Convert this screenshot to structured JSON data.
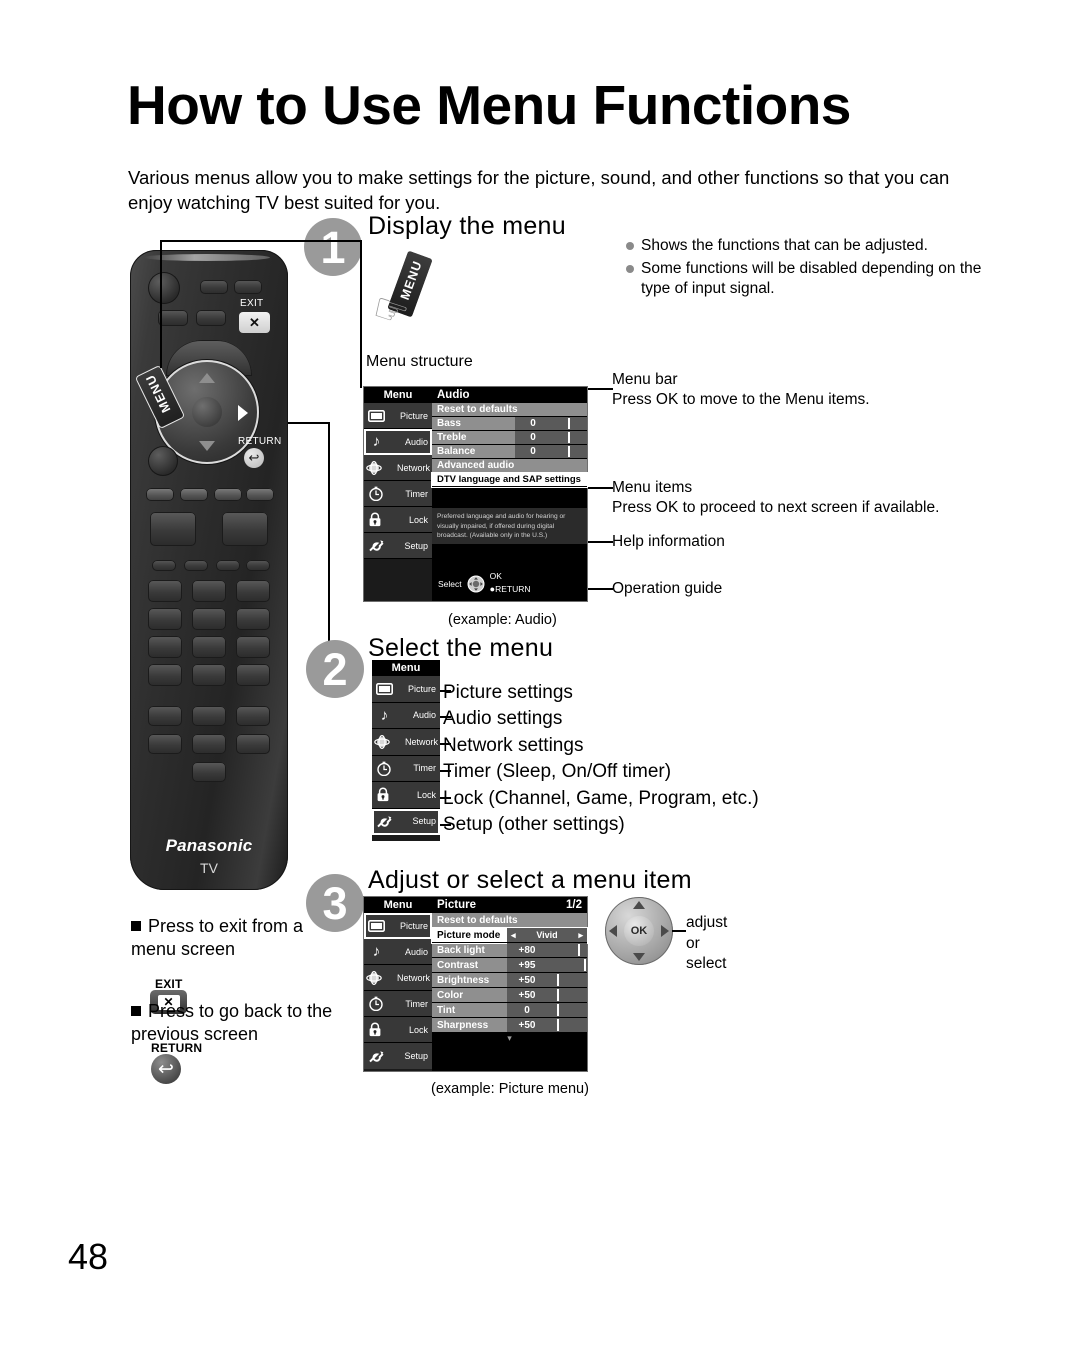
{
  "page": {
    "title": "How to Use Menu Functions",
    "intro": "Various menus allow you to make settings for the picture, sound, and other functions so that you can enjoy watching TV best suited for you.",
    "page_number": "48"
  },
  "remote": {
    "brand": "Panasonic",
    "sub_brand": "TV",
    "menu_key": "MENU",
    "exit_key_label": "EXIT",
    "exit_key_glyph": "✕",
    "return_key_label": "RETURN",
    "return_key_glyph": "↩"
  },
  "step1": {
    "number": "1",
    "title": "Display the menu",
    "press_tag": "MENU",
    "bullets": [
      "Shows the functions that can be adjusted.",
      "Some functions will be disabled depending on the type of input signal."
    ],
    "menu_structure_label": "Menu structure",
    "caption": "(example: Audio)",
    "callouts": [
      {
        "title": "Menu bar",
        "desc": "Press OK to move to the Menu items."
      },
      {
        "title": "Menu items",
        "desc": "Press OK to proceed to next screen if available."
      },
      {
        "title": "Help information",
        "desc": ""
      },
      {
        "title": "Operation guide",
        "desc": ""
      }
    ],
    "osd": {
      "sidebar_title": "Menu",
      "sidebar_items": [
        {
          "label": "Picture",
          "icon": "picture-icon",
          "selected": false
        },
        {
          "label": "Audio",
          "icon": "audio-icon",
          "selected": true
        },
        {
          "label": "Network",
          "icon": "network-icon",
          "selected": false
        },
        {
          "label": "Timer",
          "icon": "timer-icon",
          "selected": false
        },
        {
          "label": "Lock",
          "icon": "lock-icon",
          "selected": false
        },
        {
          "label": "Setup",
          "icon": "setup-icon",
          "selected": false
        }
      ],
      "main_title": "Audio",
      "page_indicator": "",
      "rows": [
        {
          "name": "Reset to defaults",
          "value": "",
          "type": "plain",
          "bar": null
        },
        {
          "name": "Bass",
          "value": "0",
          "type": "slider",
          "bar": 50
        },
        {
          "name": "Treble",
          "value": "0",
          "type": "slider",
          "bar": 50
        },
        {
          "name": "Balance",
          "value": "0",
          "type": "slider",
          "bar": 50
        },
        {
          "name": "Advanced audio",
          "value": "",
          "type": "plain",
          "bar": null
        },
        {
          "name": "DTV language and SAP settings",
          "value": "",
          "type": "highlight",
          "bar": null
        }
      ],
      "help_text": "Preferred language and audio for hearing or visually impaired, if offered during digital broadcast. (Available only in the U.S.)",
      "guide": {
        "select": "Select",
        "ok": "OK",
        "return": "RETURN"
      }
    }
  },
  "step2": {
    "number": "2",
    "title": "Select the menu",
    "osd_title": "Menu",
    "items": [
      {
        "label": "Picture",
        "icon": "picture-icon",
        "desc": "Picture settings",
        "selected": false
      },
      {
        "label": "Audio",
        "icon": "audio-icon",
        "desc": "Audio settings",
        "selected": false
      },
      {
        "label": "Network",
        "icon": "network-icon",
        "desc": "Network settings",
        "selected": false
      },
      {
        "label": "Timer",
        "icon": "timer-icon",
        "desc": "Timer (Sleep, On/Off timer)",
        "selected": false
      },
      {
        "label": "Lock",
        "icon": "lock-icon",
        "desc": "Lock (Channel, Game, Program, etc.)",
        "selected": false
      },
      {
        "label": "Setup",
        "icon": "setup-icon",
        "desc": "Setup (other settings)",
        "selected": true
      }
    ]
  },
  "step3": {
    "number": "3",
    "title": "Adjust or select a menu item",
    "caption": "(example: Picture menu)",
    "adjust_label": "adjust\nor\nselect",
    "ok_label": "OK",
    "notes": [
      {
        "text": "Press to exit from a menu screen",
        "key_label": "EXIT",
        "key_glyph": "✕"
      },
      {
        "text": "Press to go back to the previous screen",
        "key_label": "RETURN",
        "key_glyph": "↩"
      }
    ],
    "osd": {
      "sidebar_title": "Menu",
      "sidebar_items": [
        {
          "label": "Picture",
          "icon": "picture-icon",
          "selected": true
        },
        {
          "label": "Audio",
          "icon": "audio-icon",
          "selected": false
        },
        {
          "label": "Network",
          "icon": "network-icon",
          "selected": false
        },
        {
          "label": "Timer",
          "icon": "timer-icon",
          "selected": false
        },
        {
          "label": "Lock",
          "icon": "lock-icon",
          "selected": false
        },
        {
          "label": "Setup",
          "icon": "setup-icon",
          "selected": false
        }
      ],
      "main_title": "Picture",
      "page_indicator": "1/2",
      "rows": [
        {
          "name": "Reset to defaults",
          "value": "",
          "type": "plain",
          "bar": null
        },
        {
          "name": "Picture mode",
          "value": "Vivid",
          "type": "highlight-arrows",
          "bar": null
        },
        {
          "name": "Back light",
          "value": "+80",
          "type": "slider",
          "bar": 80
        },
        {
          "name": "Contrast",
          "value": "+95",
          "type": "slider",
          "bar": 95
        },
        {
          "name": "Brightness",
          "value": "+50",
          "type": "slider",
          "bar": 50
        },
        {
          "name": "Color",
          "value": "+50",
          "type": "slider",
          "bar": 50
        },
        {
          "name": "Tint",
          "value": "0",
          "type": "slider",
          "bar": 50
        },
        {
          "name": "Sharpness",
          "value": "+50",
          "type": "slider",
          "bar": 50
        }
      ],
      "scroll_glyph": "▾"
    }
  },
  "colors": {
    "badge_gray": "#9a9a9a",
    "osd_row_gray": "#8f8f8f",
    "osd_value_gray": "#5a5a5a",
    "osd_sidebar": "#383838",
    "osd_black": "#000000",
    "highlight_white": "#ffffff"
  }
}
